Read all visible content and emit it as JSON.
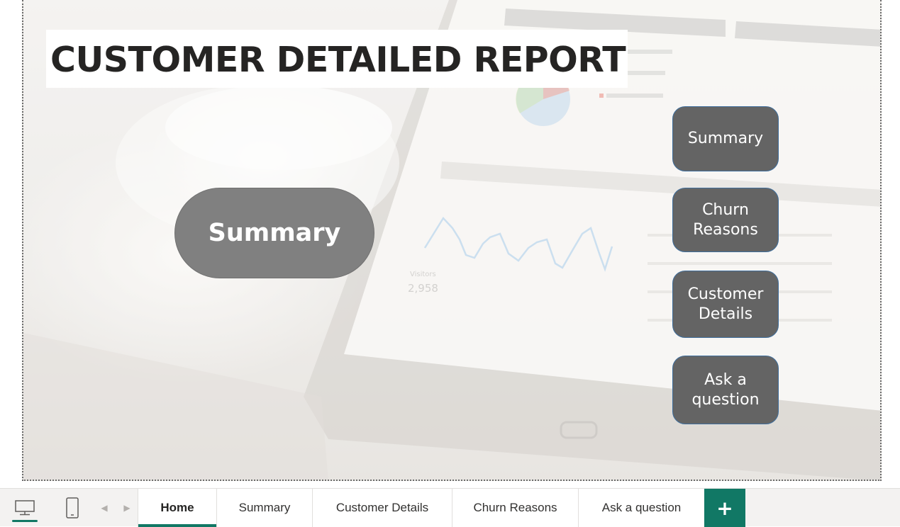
{
  "report": {
    "title": "CUSTOMER DETAILED REPORT",
    "center_button_label": "Summary"
  },
  "nav_buttons": [
    {
      "label_lines": [
        "Summary"
      ]
    },
    {
      "label_lines": [
        "Churn",
        "Reasons"
      ]
    },
    {
      "label_lines": [
        "Customer",
        "Details"
      ]
    },
    {
      "label_lines": [
        "Ask a",
        "question"
      ]
    }
  ],
  "bottom_bar": {
    "view_icons": [
      "desktop-icon",
      "phone-icon"
    ],
    "prev_arrow": "◀",
    "next_arrow": "▶",
    "tabs": [
      {
        "label": "Home",
        "active": true
      },
      {
        "label": "Summary",
        "active": false
      },
      {
        "label": "Customer Details",
        "active": false
      },
      {
        "label": "Churn Reasons",
        "active": false
      },
      {
        "label": "Ask a question",
        "active": false
      }
    ],
    "add_tab_symbol": "+"
  },
  "colors": {
    "accent": "#117865",
    "nav_button_fill": "#646464",
    "nav_button_border": "#3f6e9c",
    "center_button_fill": "#808080",
    "title_text": "#252423"
  }
}
